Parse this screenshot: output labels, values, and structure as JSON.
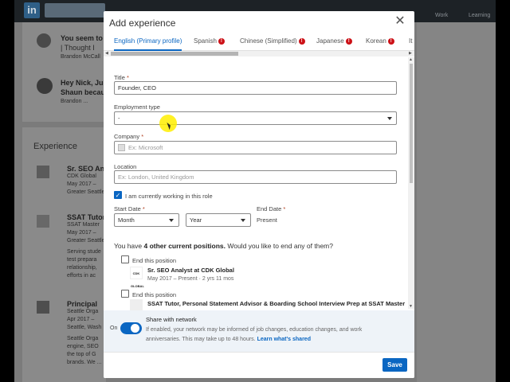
{
  "background_page": {
    "logo_text": "in",
    "nav_label_1": "Work",
    "nav_label_2": "Learning",
    "section_experience": "Experience",
    "feed_1_title": "You seem to",
    "feed_1_line2": "| Thought I",
    "feed_1_line3": "Brandon McCall",
    "feed_2_title": "Hey Nick, Just",
    "feed_2_line2": "Shaun because",
    "feed_2_line3": "Brandon ...",
    "exp_1_title": "Sr. SEO Anal",
    "exp_1_line2": "CDK Global",
    "exp_1_line3": "May 2017 –",
    "exp_1_line4": "Greater Seattle",
    "exp_2_title": "SSAT Tutor,",
    "exp_2_line2": "SSAT Master",
    "exp_2_line3": "May 2017 –",
    "exp_2_line4": "Greater Seattle",
    "exp_2_desc1": "Serving stude",
    "exp_2_desc2": "test prepara",
    "exp_2_desc3": "relationship,",
    "exp_2_desc4": "efforts in ac",
    "exp_3_title": "Principal",
    "exp_3_line2": "Seattle Orga",
    "exp_3_line3": "Apr 2017 –",
    "exp_3_line4": "Seattle, Wash",
    "exp_3_desc1": "Seattle Orga",
    "exp_3_desc2": "engine, SEO",
    "exp_3_desc3": "the top of G",
    "exp_3_desc4": "brands. We ..."
  },
  "modal": {
    "title": "Add experience",
    "close_icon": "close-icon",
    "tabs": [
      {
        "label": "English (Primary profile)",
        "active": true,
        "badge": ""
      },
      {
        "label": "Spanish",
        "active": false,
        "badge": "!"
      },
      {
        "label": "Chinese (Simplified)",
        "active": false,
        "badge": "!"
      },
      {
        "label": "Japanese",
        "active": false,
        "badge": "!"
      },
      {
        "label": "Korean",
        "active": false,
        "badge": "!"
      },
      {
        "label": "It",
        "active": false,
        "badge": ""
      }
    ],
    "form": {
      "title_label": "Title",
      "title_required": "*",
      "title_value": "Founder, CEO",
      "employment_type_label": "Employment type",
      "employment_type_value": "-",
      "company_label": "Company",
      "company_required": "*",
      "company_placeholder": "Ex: Microsoft",
      "location_label": "Location",
      "location_placeholder": "Ex: London, United Kingdom",
      "currently_working_label": "I am currently working in this role",
      "currently_working_checked": true,
      "start_date_label": "Start Date",
      "start_date_required": "*",
      "start_month": "Month",
      "start_year": "Year",
      "end_date_label": "End Date",
      "end_date_required": "*",
      "end_date_value": "Present",
      "question_prefix": "You have ",
      "question_bold": "4 other current positions.",
      "question_suffix": " Would you like to end any of them?",
      "positions": [
        {
          "end_label": "End this position",
          "logo_text": "CDK GLOBAL",
          "title": "Sr. SEO Analyst at CDK Global",
          "dates": "May 2017 – Present · 2 yrs 11 mos"
        },
        {
          "end_label": "End this position",
          "logo_text": "",
          "title": "SSAT Tutor, Personal Statement Advisor & Boarding School Interview Prep at SSAT Master",
          "dates": ""
        }
      ]
    },
    "share": {
      "toggle_state": "On",
      "title": "Share with network",
      "desc_line1": "If enabled, your network may be informed of job changes, education changes, and work",
      "desc_line2": "anniversaries. This may take up to 48 hours.",
      "link": "Learn what's shared"
    },
    "save_label": "Save"
  },
  "colors": {
    "accent": "#0a66c2",
    "badge": "#cc1016",
    "cursor_highlight": "#ffee00"
  }
}
